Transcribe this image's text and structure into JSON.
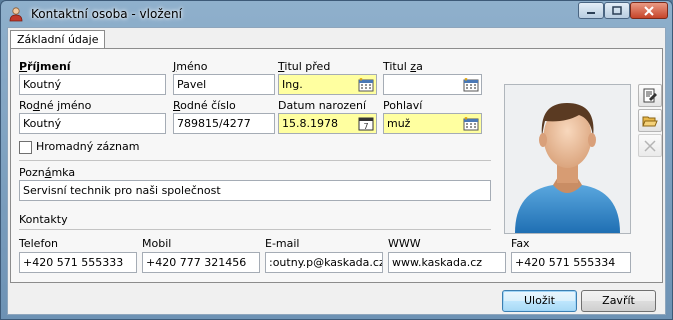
{
  "window": {
    "title": "Kontaktní osoba - vložení"
  },
  "tabs": [
    {
      "label": "Základní údaje",
      "active": true
    }
  ],
  "form": {
    "surname": {
      "label_pre": "",
      "label_ul": "P",
      "label_post": "říjmení",
      "value": "Koutný"
    },
    "first_name": {
      "label_pre": "",
      "label_ul": "J",
      "label_post": "méno",
      "value": "Pavel"
    },
    "title_before": {
      "label_pre": "",
      "label_ul": "T",
      "label_post": "itul před",
      "value": "Ing."
    },
    "title_after": {
      "label_pre": "Titul ",
      "label_ul": "z",
      "label_post": "a",
      "value": ""
    },
    "maiden_name": {
      "label_pre": "Ro",
      "label_ul": "d",
      "label_post": "né jméno",
      "value": "Koutný"
    },
    "birth_number": {
      "label_pre": "",
      "label_ul": "R",
      "label_post": "odné číslo",
      "value": "789815/4277"
    },
    "birth_date": {
      "label": "Datum narození",
      "value": "15.8.1978"
    },
    "gender": {
      "label": "Pohlaví",
      "value": "muž"
    },
    "bulk_record": {
      "label": "Hromadný záznam",
      "checked": false
    },
    "note": {
      "label_pre": "Pozn",
      "label_ul": "á",
      "label_post": "mka",
      "value": "Servisní technik pro naši společnost"
    }
  },
  "contacts": {
    "section_label": "Kontakty",
    "phone": {
      "label": "Telefon",
      "value": "+420 571 555333"
    },
    "mobile": {
      "label": "Mobil",
      "value": "+420 777 321456"
    },
    "email": {
      "label": "E-mail",
      "value": ":outny.p@kaskada.cz"
    },
    "www": {
      "label": "WWW",
      "value": "www.kaskada.cz"
    },
    "fax": {
      "label": "Fax",
      "value": "+420 571 555334"
    }
  },
  "buttons": {
    "save": "Uložit",
    "close": "Zavřít"
  },
  "colors": {
    "required_field": "#ffffa0",
    "default_button_border": "#3c7fb1"
  },
  "icons": {
    "side_1": "edit-document-icon",
    "side_2": "open-folder-icon",
    "side_3": "delete-x-icon"
  }
}
